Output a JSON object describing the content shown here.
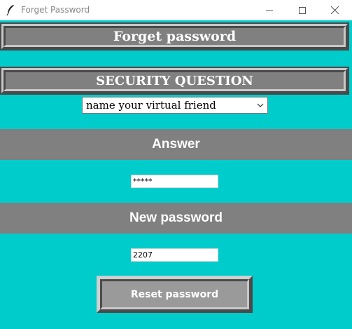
{
  "window": {
    "title": "Forget Password"
  },
  "header": {
    "title": "Forget password"
  },
  "security": {
    "heading": "SECURITY QUESTION",
    "question_selected": "name your virtual friend"
  },
  "answer": {
    "label": "Answer",
    "value": "*****"
  },
  "new_password": {
    "label": "New password",
    "value": "2207"
  },
  "actions": {
    "reset_label": "Reset password"
  },
  "colors": {
    "background": "#00cccc",
    "panel": "#808080",
    "text": "#ffffff"
  }
}
